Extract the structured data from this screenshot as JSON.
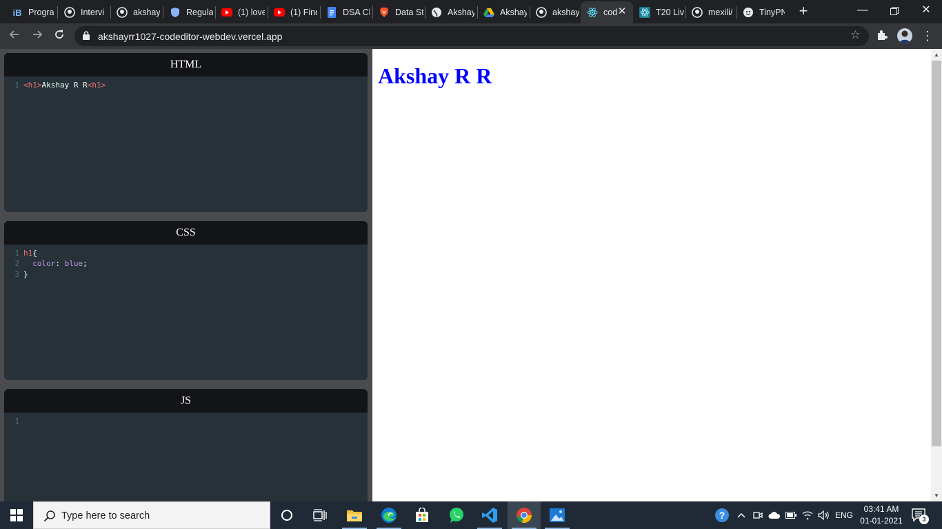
{
  "browser": {
    "tabs": [
      {
        "label": "Progra",
        "icon": "interviewbit-icon",
        "glyph": "iB"
      },
      {
        "label": "Intervi",
        "icon": "github-icon"
      },
      {
        "label": "akshay",
        "icon": "github-icon"
      },
      {
        "label": "Regula",
        "icon": "shield-icon"
      },
      {
        "label": "(1) love",
        "icon": "youtube-icon"
      },
      {
        "label": "(1) Find",
        "icon": "youtube-icon"
      },
      {
        "label": "DSA Ch",
        "icon": "google-docs-icon"
      },
      {
        "label": "Data St",
        "icon": "brave-icon"
      },
      {
        "label": "Akshay",
        "icon": "globe-icon"
      },
      {
        "label": "Akshay",
        "icon": "google-drive-icon"
      },
      {
        "label": "akshay",
        "icon": "github-icon"
      },
      {
        "label": "code",
        "icon": "react-icon",
        "active": true
      },
      {
        "label": "T20 Liv",
        "icon": "react-icon"
      },
      {
        "label": "mexili/",
        "icon": "github-icon"
      },
      {
        "label": "TinyPN",
        "icon": "tinypng-icon"
      }
    ],
    "url": "akshayrr1027-codeditor-webdev.vercel.app"
  },
  "editors": {
    "html": {
      "title": "HTML",
      "lines": [
        {
          "n": "1",
          "open": "<h1>",
          "text": "Akshay R R",
          "close": "<h1>"
        }
      ]
    },
    "css": {
      "title": "CSS",
      "line1": {
        "n": "1",
        "selector": "h1",
        "brace": "{"
      },
      "line2": {
        "n": "2",
        "prop": "color",
        "colon": ": ",
        "value": "blue",
        "semi": ";"
      },
      "line3": {
        "n": "3",
        "brace": "}"
      }
    },
    "js": {
      "title": "JS",
      "line1": {
        "n": "1"
      }
    }
  },
  "preview": {
    "heading": "Akshay R R",
    "heading_color": "#0000ff"
  },
  "taskbar": {
    "search_placeholder": "Type here to search",
    "pinned": [
      "cortana-icon",
      "task-view-icon",
      "file-explorer-icon",
      "edge-icon",
      "store-icon",
      "whatsapp-icon",
      "vscode-icon",
      "chrome-icon",
      "photos-icon"
    ],
    "language": "ENG",
    "time": "03:41 AM",
    "date": "01-01-2021",
    "notification_count": "3"
  }
}
